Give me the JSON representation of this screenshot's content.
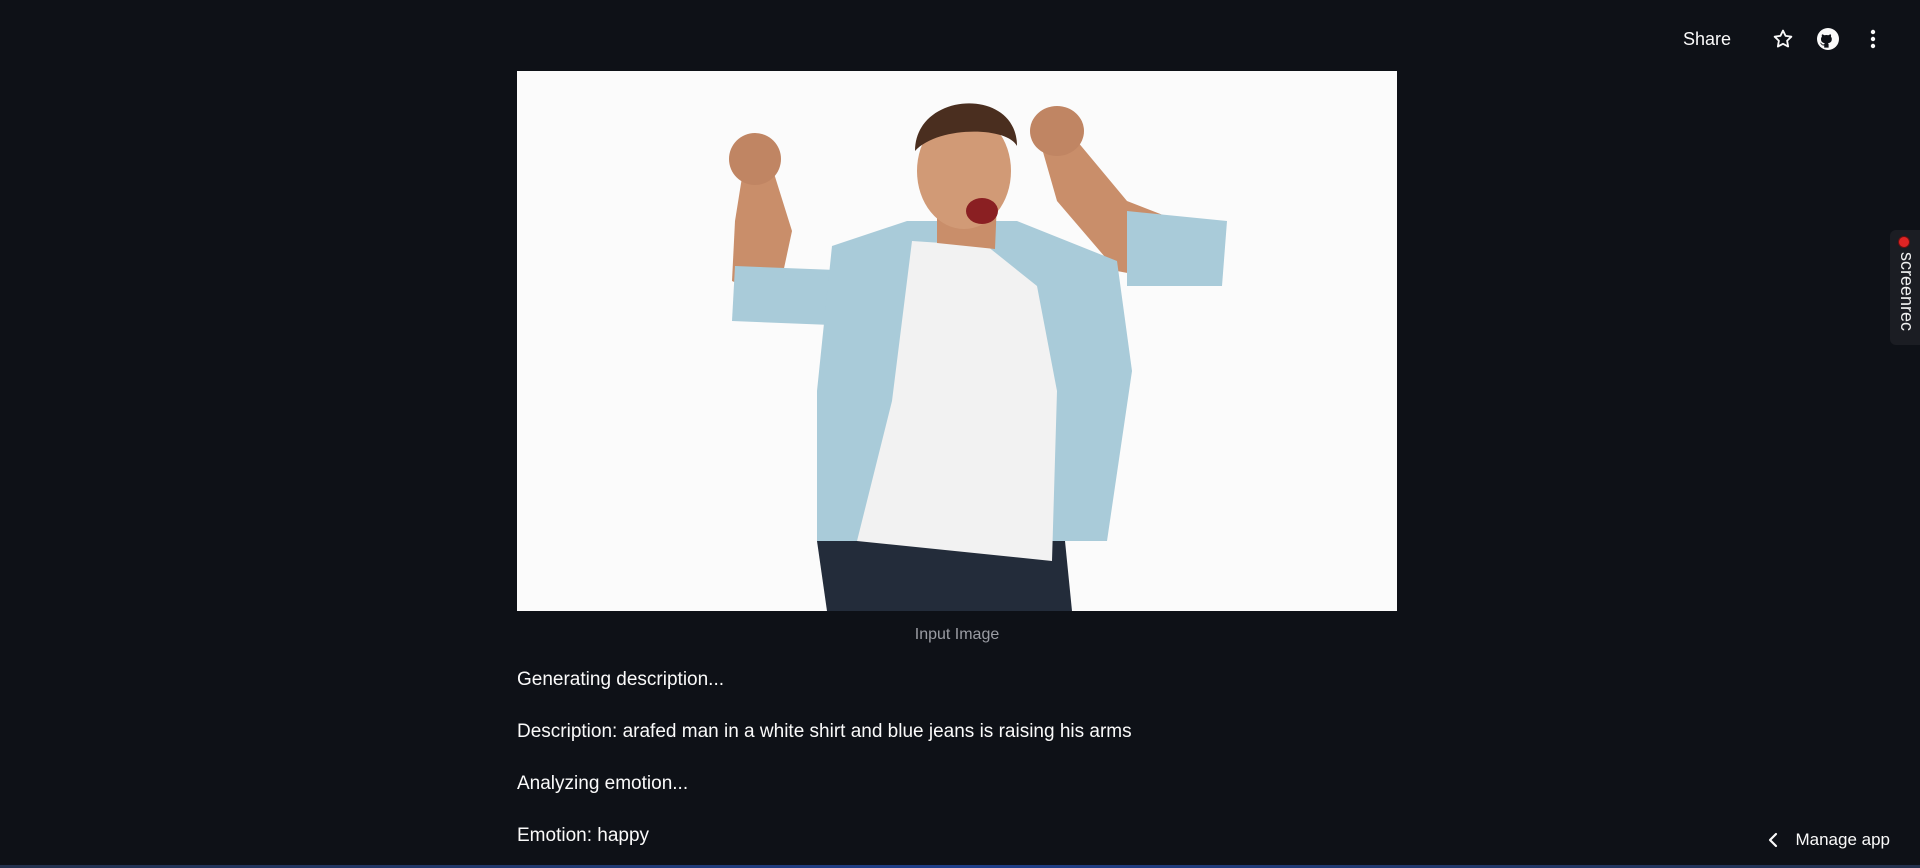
{
  "header": {
    "share_label": "Share",
    "icons": [
      "star-icon",
      "github-icon",
      "more-vertical-icon"
    ]
  },
  "image": {
    "caption": "Input Image"
  },
  "output": {
    "line1": "Generating description...",
    "line2": "Description: arafed man in a white shirt and blue jeans is raising his arms",
    "line3": "Analyzing emotion...",
    "line4": "Emotion: happy"
  },
  "screenrec": {
    "label": "screenrec"
  },
  "footer": {
    "manage_label": "Manage app"
  },
  "colors": {
    "background": "#0e1117",
    "text": "#fafafa",
    "caption": "#9a9ca3",
    "shirt": "#a9cbd9",
    "tee": "#f2f2f2",
    "jeans": "#232c3a",
    "recording_dot": "#e02424"
  }
}
